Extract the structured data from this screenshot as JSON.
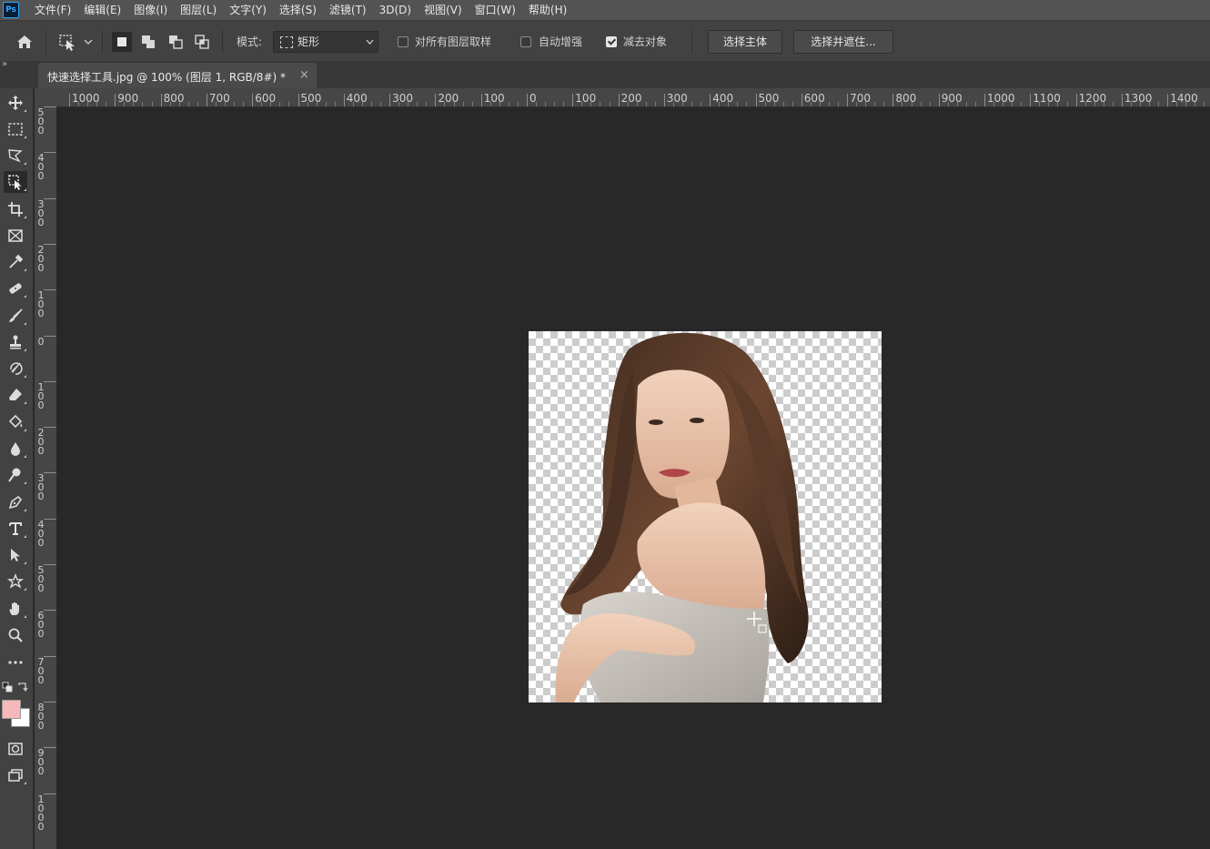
{
  "app": {
    "logo_text": "Ps"
  },
  "menu": [
    "文件(F)",
    "编辑(E)",
    "图像(I)",
    "图层(L)",
    "文字(Y)",
    "选择(S)",
    "滤镜(T)",
    "3D(D)",
    "视图(V)",
    "窗口(W)",
    "帮助(H)"
  ],
  "options": {
    "mode_label": "模式:",
    "mode_value": "矩形",
    "sample_all_layers": {
      "label": "对所有图层取样",
      "checked": false
    },
    "auto_enhance": {
      "label": "自动增强",
      "checked": false
    },
    "subtract_object": {
      "label": "减去对象",
      "checked": true
    },
    "select_subject_button": "选择主体",
    "select_and_mask_button": "选择并遮住..."
  },
  "document_tab": {
    "title": "快速选择工具.jpg @ 100% (图层 1, RGB/8#) *",
    "close_glyph": "×"
  },
  "toolbar": {
    "expand_glyph": "»"
  },
  "ruler_top_labels": [
    "1000",
    "900",
    "800",
    "700",
    "600",
    "500",
    "400",
    "300",
    "200",
    "100",
    "0",
    "100",
    "200",
    "300",
    "400",
    "500",
    "600",
    "700",
    "800",
    "900",
    "1000",
    "1100",
    "1200",
    "1300",
    "1400"
  ],
  "ruler_left_labels": [
    [
      "5",
      "0",
      "0"
    ],
    [
      "4",
      "0",
      "0"
    ],
    [
      "3",
      "0",
      "0"
    ],
    [
      "2",
      "0",
      "0"
    ],
    [
      "1",
      "0",
      "0"
    ],
    [
      "0"
    ],
    [
      "1",
      "0",
      "0"
    ],
    [
      "2",
      "0",
      "0"
    ],
    [
      "3",
      "0",
      "0"
    ],
    [
      "4",
      "0",
      "0"
    ],
    [
      "5",
      "0",
      "0"
    ],
    [
      "6",
      "0",
      "0"
    ],
    [
      "7",
      "0",
      "0"
    ],
    [
      "8",
      "0",
      "0"
    ],
    [
      "9",
      "0",
      "0"
    ],
    [
      "1",
      "0",
      "0",
      "0"
    ]
  ],
  "colors": {
    "foreground": "#f7b8bc",
    "background": "#ffffff",
    "ui_dark": "#282828",
    "ui_panel": "#424242"
  }
}
